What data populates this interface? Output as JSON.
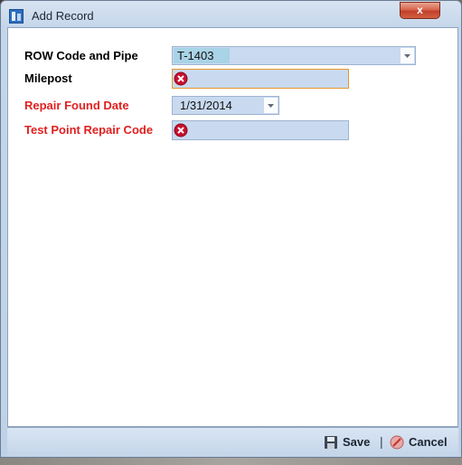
{
  "window": {
    "title": "Add Record",
    "close_glyph": "x"
  },
  "form": {
    "row_code": {
      "label": "ROW Code and Pipe",
      "value": "T-1403",
      "required": false
    },
    "milepost": {
      "label": "Milepost",
      "value": "",
      "required": false,
      "has_error": true
    },
    "repair_found_date": {
      "label": "Repair Found Date",
      "value": "1/31/2014",
      "required": true
    },
    "test_point_repair_code": {
      "label": "Test Point Repair Code",
      "value": "",
      "required": true,
      "has_error": true
    }
  },
  "footer": {
    "save_label": "Save",
    "separator": "|",
    "cancel_label": "Cancel"
  },
  "icons": {
    "app": "app-icon",
    "error": "error-icon",
    "save": "floppy-disk-icon",
    "cancel": "cancel-circle-icon",
    "dropdown": "chevron-down-icon"
  },
  "colors": {
    "required_label": "#e02020",
    "field_bg": "#c9daf0",
    "focus_border": "#e5972c",
    "error_icon": "#c8102e"
  }
}
